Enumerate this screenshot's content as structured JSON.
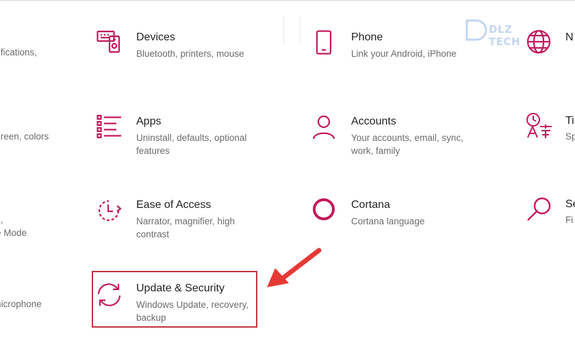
{
  "colors": {
    "accent": "#c2185b",
    "highlight": "#c1333f",
    "arrow": "#e53935",
    "watermark": "#2a6fc9"
  },
  "left_partial": [
    {
      "text": "tifications,"
    },
    {
      "text": "creen, colors"
    },
    {
      "text": "s,"
    },
    {
      "text": "e Mode"
    },
    {
      "text": "nicrophone"
    }
  ],
  "tiles": [
    {
      "icon": "devices-icon",
      "title": "Devices",
      "desc": "Bluetooth, printers, mouse"
    },
    {
      "icon": "phone-icon",
      "title": "Phone",
      "desc": "Link your Android, iPhone"
    },
    {
      "icon": "apps-icon",
      "title": "Apps",
      "desc": "Uninstall, defaults, optional features"
    },
    {
      "icon": "accounts-icon",
      "title": "Accounts",
      "desc": "Your accounts, email, sync, work, family"
    },
    {
      "icon": "ease-of-access-icon",
      "title": "Ease of Access",
      "desc": "Narrator, magnifier, high contrast"
    },
    {
      "icon": "cortana-icon",
      "title": "Cortana",
      "desc": "Cortana language"
    },
    {
      "icon": "update-security-icon",
      "title": "Update & Security",
      "desc": "Windows Update, recovery, backup"
    }
  ],
  "right_partial": [
    {
      "icon": "network-globe-icon",
      "title": "N",
      "desc": ""
    },
    {
      "icon": "time-language-icon",
      "title": "Ti",
      "desc": "Sp"
    },
    {
      "icon": "search-icon",
      "title": "Se",
      "desc": "Fi"
    }
  ],
  "watermark": {
    "text": "DLZ TECH"
  }
}
